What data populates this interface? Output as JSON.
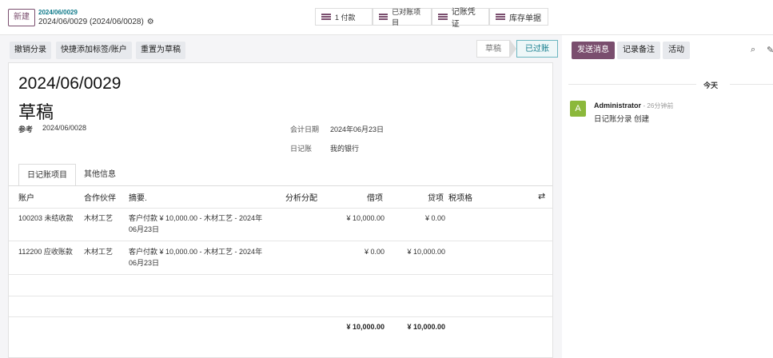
{
  "topbar": {
    "new_label": "新建",
    "breadcrumb_parent": "2024/06/0029",
    "breadcrumb_current": "2024/06/0029 (2024/06/0028)",
    "smart_buttons": [
      {
        "label": "1 付款"
      },
      {
        "label": "已对账项目"
      },
      {
        "label": "记账凭证"
      },
      {
        "label": "库存单据"
      }
    ]
  },
  "control": {
    "buttons": [
      "撤销分录",
      "快捷添加标签/账户",
      "重置为草稿"
    ],
    "status_steps": [
      "草稿",
      "已过账"
    ],
    "active_status": "已过账"
  },
  "record": {
    "name": "2024/06/0029",
    "state": "草稿",
    "ref_label": "参考",
    "ref_value": "2024/06/0028",
    "date_label": "会计日期",
    "date_value": "2024年06月23日",
    "journal_label": "日记账",
    "journal_value": "我的银行"
  },
  "tabs": [
    "日记账项目",
    "其他信息"
  ],
  "table": {
    "headers": {
      "account": "账户",
      "partner": "合作伙伴",
      "label": "摘要.",
      "analytic": "分析分配",
      "debit": "借项",
      "credit": "贷项",
      "tax": "税项格"
    },
    "rows": [
      {
        "account": "100203 未结收款",
        "partner": "木材工艺",
        "label1": "客户付款 ¥ 10,000.00 - 木材工艺 - 2024年",
        "label2": "06月23日",
        "debit": "¥ 10,000.00",
        "credit": "¥ 0.00"
      },
      {
        "account": "112200 应收账款",
        "partner": "木材工艺",
        "label1": "客户付款 ¥ 10,000.00 - 木材工艺 - 2024年",
        "label2": "06月23日",
        "debit": "¥ 0.00",
        "credit": "¥ 10,000.00"
      }
    ],
    "total_debit": "¥ 10,000.00",
    "total_credit": "¥ 10,000.00"
  },
  "chatter": {
    "send_label": "发送消息",
    "note_label": "记录备注",
    "activity_label": "活动",
    "today": "今天",
    "author": "Administrator",
    "time_ago": "- 26分钟前",
    "message": "日记账分录 创建",
    "avatar_letter": "A"
  },
  "colors": {
    "brand": "#7a4e6e",
    "accent": "#0f7a8a",
    "avatar": "#8bb83b"
  }
}
